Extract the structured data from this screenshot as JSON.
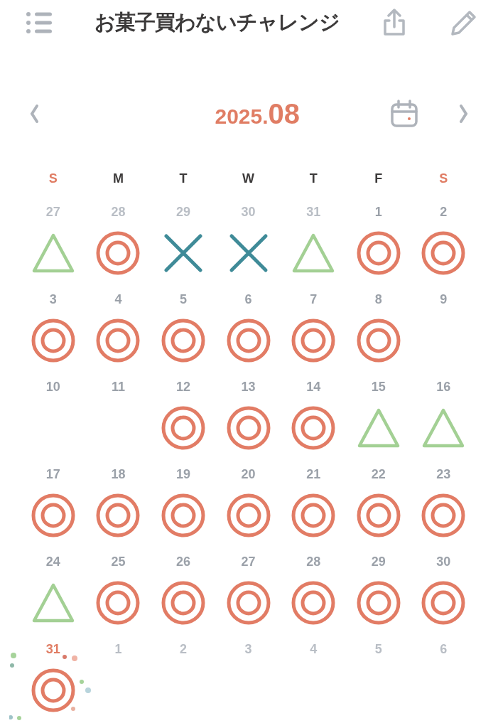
{
  "header": {
    "title": "お菓子買わないチャレンジ"
  },
  "month_nav": {
    "year": "2025.",
    "month": "08"
  },
  "weekdays": [
    {
      "label": "S",
      "weekend": true
    },
    {
      "label": "M",
      "weekend": false
    },
    {
      "label": "T",
      "weekend": false
    },
    {
      "label": "W",
      "weekend": false
    },
    {
      "label": "T",
      "weekend": false
    },
    {
      "label": "F",
      "weekend": false
    },
    {
      "label": "S",
      "weekend": true
    }
  ],
  "weeks": [
    [
      {
        "date": "27",
        "faded": true,
        "kind": "triangle"
      },
      {
        "date": "28",
        "faded": true,
        "kind": "double_circle"
      },
      {
        "date": "29",
        "faded": true,
        "kind": "cross"
      },
      {
        "date": "30",
        "faded": true,
        "kind": "cross"
      },
      {
        "date": "31",
        "faded": true,
        "kind": "triangle"
      },
      {
        "date": "1",
        "faded": false,
        "kind": "double_circle"
      },
      {
        "date": "2",
        "faded": false,
        "kind": "double_circle"
      }
    ],
    [
      {
        "date": "3",
        "faded": false,
        "kind": "double_circle"
      },
      {
        "date": "4",
        "faded": false,
        "kind": "double_circle"
      },
      {
        "date": "5",
        "faded": false,
        "kind": "double_circle"
      },
      {
        "date": "6",
        "faded": false,
        "kind": "double_circle"
      },
      {
        "date": "7",
        "faded": false,
        "kind": "double_circle"
      },
      {
        "date": "8",
        "faded": false,
        "kind": "double_circle"
      },
      {
        "date": "9",
        "faded": false
      }
    ],
    [
      {
        "date": "10",
        "faded": false
      },
      {
        "date": "11",
        "faded": false
      },
      {
        "date": "12",
        "faded": false,
        "kind": "double_circle"
      },
      {
        "date": "13",
        "faded": false,
        "kind": "double_circle"
      },
      {
        "date": "14",
        "faded": false,
        "kind": "double_circle"
      },
      {
        "date": "15",
        "faded": false,
        "kind": "triangle"
      },
      {
        "date": "16",
        "faded": false,
        "kind": "triangle"
      }
    ],
    [
      {
        "date": "17",
        "faded": false,
        "kind": "double_circle"
      },
      {
        "date": "18",
        "faded": false,
        "kind": "double_circle"
      },
      {
        "date": "19",
        "faded": false,
        "kind": "double_circle"
      },
      {
        "date": "20",
        "faded": false,
        "kind": "double_circle"
      },
      {
        "date": "21",
        "faded": false,
        "kind": "double_circle"
      },
      {
        "date": "22",
        "faded": false,
        "kind": "double_circle"
      },
      {
        "date": "23",
        "faded": false,
        "kind": "double_circle"
      }
    ],
    [
      {
        "date": "24",
        "faded": false,
        "kind": "triangle"
      },
      {
        "date": "25",
        "faded": false,
        "kind": "double_circle"
      },
      {
        "date": "26",
        "faded": false,
        "kind": "double_circle"
      },
      {
        "date": "27",
        "faded": false,
        "kind": "double_circle"
      },
      {
        "date": "28",
        "faded": false,
        "kind": "double_circle"
      },
      {
        "date": "29",
        "faded": false,
        "kind": "double_circle"
      },
      {
        "date": "30",
        "faded": false,
        "kind": "double_circle"
      }
    ],
    [
      {
        "date": "31",
        "faded": false,
        "today": true,
        "kind": "double_circle"
      },
      {
        "date": "1",
        "faded": true
      },
      {
        "date": "2",
        "faded": true
      },
      {
        "date": "3",
        "faded": true
      },
      {
        "date": "4",
        "faded": true
      },
      {
        "date": "5",
        "faded": true
      },
      {
        "date": "6",
        "faded": true
      }
    ]
  ]
}
